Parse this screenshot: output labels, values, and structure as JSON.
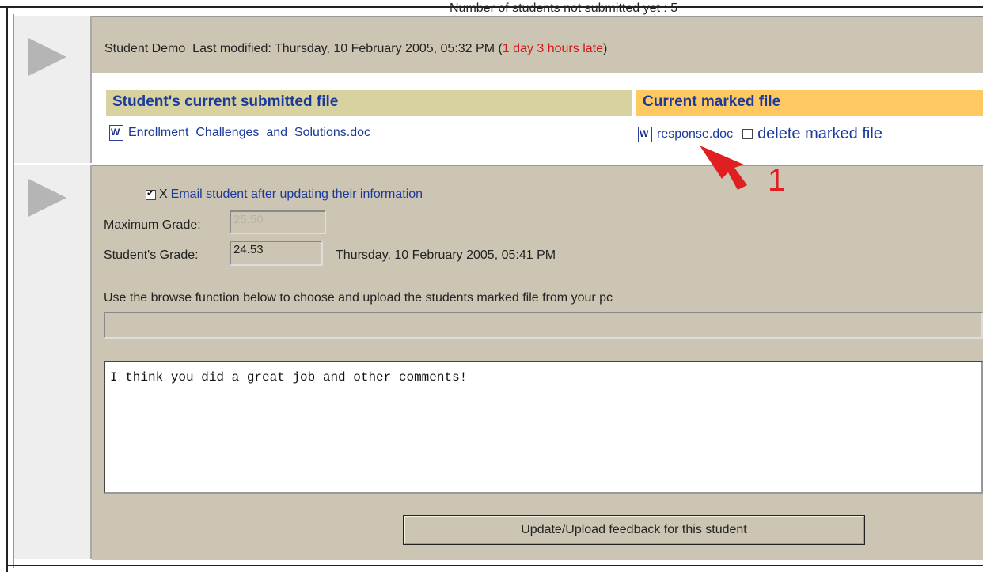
{
  "header": {
    "cut_text": "Number of students not submitted yet : 5"
  },
  "submission": {
    "student_name": "Student Demo",
    "last_modified_label": "Last modified:",
    "last_modified_value": "Thursday, 10 February 2005, 05:32 PM",
    "late_open": "(",
    "late_text": "1 day 3 hours late",
    "late_close": ")",
    "submitted_header": "Student's current submitted file",
    "marked_header": "Current marked file",
    "submitted_file": "Enrollment_Challenges_and_Solutions.doc",
    "marked_file": "response.doc",
    "delete_label": "delete marked file"
  },
  "grading": {
    "email_prefix": "X",
    "email_label": "Email student after updating their information",
    "max_grade_label": "Maximum Grade:",
    "max_grade_value": "25.50",
    "student_grade_label": "Student's Grade:",
    "student_grade_value": "24.53",
    "graded_time": "Thursday, 10 February 2005, 05:41 PM",
    "upload_instructions": "Use the browse function below to choose and upload the students marked file from your pc",
    "comment": "I think you did a great job and other comments!",
    "submit_label": "Update/Upload feedback for this student"
  },
  "annotation": {
    "number": "1",
    "color": "#e02020"
  },
  "colors": {
    "tan_bg": "#cdc5b4",
    "header_olive": "#d8d1a0",
    "header_orange": "#ffc860",
    "link_blue": "#1a3a9c",
    "late_red": "#d01818"
  },
  "icons": [
    "play-triangle-icon",
    "word-document-icon",
    "checkbox-icon",
    "red-arrow-annotation-icon"
  ]
}
